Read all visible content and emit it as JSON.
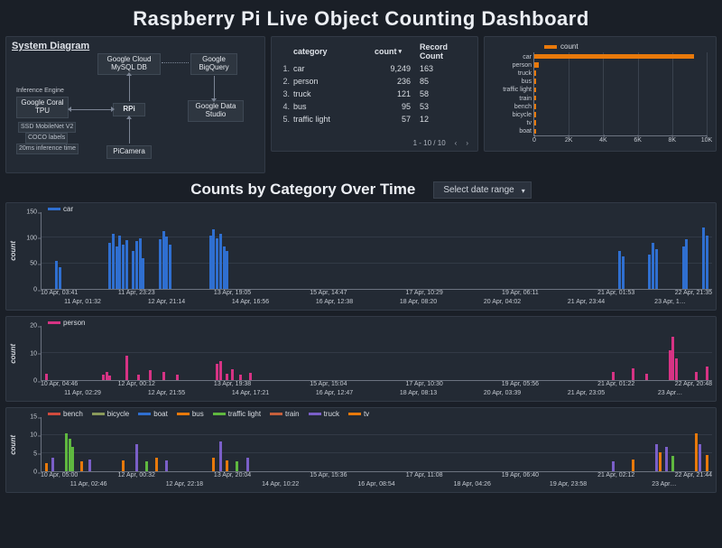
{
  "title": "Raspberry Pi Live Object Counting Dashboard",
  "section_title": "Counts by Category Over Time",
  "date_selector": {
    "label": "Select date range"
  },
  "system_diagram": {
    "title": "System Diagram",
    "nodes": {
      "gcloud": "Google Cloud\nMySQL DB",
      "bigquery": "Google\nBigQuery",
      "rpi": "RPi",
      "datastudio": "Google Data\nStudio",
      "picamera": "PiCamera",
      "inference_label": "Inference Engine",
      "coral": "Google Coral\nTPU",
      "detail1": "SSD MobileNet V2",
      "detail2": "COCO labels",
      "detail3": "20ms inference time"
    }
  },
  "table": {
    "headers": {
      "category": "category",
      "count": "count",
      "record_count": "Record Count"
    },
    "rows": [
      {
        "idx": "1.",
        "category": "car",
        "count": "9,249",
        "record_count": "163"
      },
      {
        "idx": "2.",
        "category": "person",
        "count": "236",
        "record_count": "85"
      },
      {
        "idx": "3.",
        "category": "truck",
        "count": "121",
        "record_count": "58"
      },
      {
        "idx": "4.",
        "category": "bus",
        "count": "95",
        "record_count": "53"
      },
      {
        "idx": "5.",
        "category": "traffic light",
        "count": "57",
        "record_count": "12"
      }
    ],
    "pager": "1 - 10 / 10"
  },
  "chart_data": {
    "type": "bar",
    "orientation": "horizontal",
    "title": "",
    "legend": "count",
    "xlabel": "",
    "ylabel": "",
    "xlim": [
      0,
      10000
    ],
    "xticks": [
      0,
      2000,
      4000,
      6000,
      8000,
      10000
    ],
    "xtick_labels": [
      "0",
      "2K",
      "4K",
      "6K",
      "8K",
      "10K"
    ],
    "categories": [
      "car",
      "person",
      "truck",
      "bus",
      "traffic light",
      "train",
      "bench",
      "bicycle",
      "tv",
      "boat"
    ],
    "values": [
      9249,
      236,
      121,
      95,
      57,
      40,
      30,
      25,
      20,
      15
    ],
    "color": "#e8790b"
  },
  "ts_ylabel": "count",
  "ts_car": {
    "legend": [
      {
        "name": "car",
        "color": "#2f6fd0"
      }
    ],
    "ymax": 150,
    "yticks": [
      0,
      50,
      100,
      150
    ],
    "xticks_top": [
      "10 Apr, 03:41",
      "11 Apr, 23:23",
      "13 Apr, 19:05",
      "15 Apr, 14:47",
      "17 Apr, 10:29",
      "19 Apr, 06:11",
      "21 Apr, 01:53",
      "22 Apr, 21:35"
    ],
    "xticks_bot": [
      "11 Apr, 01:32",
      "12 Apr, 21:14",
      "14 Apr, 16:56",
      "16 Apr, 12:38",
      "18 Apr, 08:20",
      "20 Apr, 04:02",
      "21 Apr, 23:44",
      "23 Apr, 1…"
    ],
    "bars": [
      {
        "x": 0.02,
        "h": 0.37,
        "c": "#2f6fd0"
      },
      {
        "x": 0.025,
        "h": 0.28,
        "c": "#2f6fd0"
      },
      {
        "x": 0.1,
        "h": 0.6,
        "c": "#2f6fd0"
      },
      {
        "x": 0.105,
        "h": 0.72,
        "c": "#2f6fd0"
      },
      {
        "x": 0.11,
        "h": 0.55,
        "c": "#2f6fd0"
      },
      {
        "x": 0.115,
        "h": 0.7,
        "c": "#2f6fd0"
      },
      {
        "x": 0.12,
        "h": 0.58,
        "c": "#2f6fd0"
      },
      {
        "x": 0.125,
        "h": 0.64,
        "c": "#2f6fd0"
      },
      {
        "x": 0.135,
        "h": 0.5,
        "c": "#2f6fd0"
      },
      {
        "x": 0.14,
        "h": 0.62,
        "c": "#2f6fd0"
      },
      {
        "x": 0.145,
        "h": 0.66,
        "c": "#2f6fd0"
      },
      {
        "x": 0.15,
        "h": 0.4,
        "c": "#2f6fd0"
      },
      {
        "x": 0.175,
        "h": 0.65,
        "c": "#2f6fd0"
      },
      {
        "x": 0.18,
        "h": 0.75,
        "c": "#2f6fd0"
      },
      {
        "x": 0.185,
        "h": 0.68,
        "c": "#2f6fd0"
      },
      {
        "x": 0.19,
        "h": 0.58,
        "c": "#2f6fd0"
      },
      {
        "x": 0.25,
        "h": 0.7,
        "c": "#2f6fd0"
      },
      {
        "x": 0.255,
        "h": 0.78,
        "c": "#2f6fd0"
      },
      {
        "x": 0.26,
        "h": 0.66,
        "c": "#2f6fd0"
      },
      {
        "x": 0.265,
        "h": 0.72,
        "c": "#2f6fd0"
      },
      {
        "x": 0.27,
        "h": 0.55,
        "c": "#2f6fd0"
      },
      {
        "x": 0.275,
        "h": 0.5,
        "c": "#2f6fd0"
      },
      {
        "x": 0.86,
        "h": 0.5,
        "c": "#2f6fd0"
      },
      {
        "x": 0.865,
        "h": 0.42,
        "c": "#2f6fd0"
      },
      {
        "x": 0.905,
        "h": 0.45,
        "c": "#2f6fd0"
      },
      {
        "x": 0.91,
        "h": 0.6,
        "c": "#2f6fd0"
      },
      {
        "x": 0.915,
        "h": 0.52,
        "c": "#2f6fd0"
      },
      {
        "x": 0.955,
        "h": 0.55,
        "c": "#2f6fd0"
      },
      {
        "x": 0.96,
        "h": 0.65,
        "c": "#2f6fd0"
      },
      {
        "x": 0.985,
        "h": 0.8,
        "c": "#2f6fd0"
      },
      {
        "x": 0.99,
        "h": 0.7,
        "c": "#2f6fd0"
      }
    ]
  },
  "ts_person": {
    "legend": [
      {
        "name": "person",
        "color": "#d63384"
      }
    ],
    "ymax": 20,
    "yticks": [
      0,
      10,
      20
    ],
    "xticks_top": [
      "10 Apr, 04:46",
      "12 Apr, 00:12",
      "13 Apr, 19:38",
      "15 Apr, 15:04",
      "17 Apr, 10:30",
      "19 Apr, 05:56",
      "21 Apr, 01:22",
      "22 Apr, 20:48"
    ],
    "xticks_bot": [
      "11 Apr, 02:29",
      "12 Apr, 21:55",
      "14 Apr, 17:21",
      "16 Apr, 12:47",
      "18 Apr, 08:13",
      "20 Apr, 03:39",
      "21 Apr, 23:05",
      "23 Apr…"
    ],
    "bars": [
      {
        "x": 0.005,
        "h": 0.12,
        "c": "#d63384"
      },
      {
        "x": 0.09,
        "h": 0.1,
        "c": "#d63384"
      },
      {
        "x": 0.095,
        "h": 0.15,
        "c": "#d63384"
      },
      {
        "x": 0.1,
        "h": 0.08,
        "c": "#d63384"
      },
      {
        "x": 0.125,
        "h": 0.45,
        "c": "#d63384"
      },
      {
        "x": 0.143,
        "h": 0.1,
        "c": "#d63384"
      },
      {
        "x": 0.16,
        "h": 0.18,
        "c": "#d63384"
      },
      {
        "x": 0.18,
        "h": 0.15,
        "c": "#d63384"
      },
      {
        "x": 0.2,
        "h": 0.1,
        "c": "#d63384"
      },
      {
        "x": 0.26,
        "h": 0.3,
        "c": "#d63384"
      },
      {
        "x": 0.265,
        "h": 0.35,
        "c": "#d63384"
      },
      {
        "x": 0.275,
        "h": 0.12,
        "c": "#d63384"
      },
      {
        "x": 0.283,
        "h": 0.2,
        "c": "#d63384"
      },
      {
        "x": 0.295,
        "h": 0.1,
        "c": "#d63384"
      },
      {
        "x": 0.31,
        "h": 0.14,
        "c": "#d63384"
      },
      {
        "x": 0.85,
        "h": 0.15,
        "c": "#d63384"
      },
      {
        "x": 0.88,
        "h": 0.22,
        "c": "#d63384"
      },
      {
        "x": 0.9,
        "h": 0.12,
        "c": "#d63384"
      },
      {
        "x": 0.935,
        "h": 0.55,
        "c": "#d63384"
      },
      {
        "x": 0.94,
        "h": 0.8,
        "c": "#d63384"
      },
      {
        "x": 0.945,
        "h": 0.4,
        "c": "#d63384"
      },
      {
        "x": 0.975,
        "h": 0.15,
        "c": "#d63384"
      },
      {
        "x": 0.99,
        "h": 0.25,
        "c": "#d63384"
      }
    ]
  },
  "ts_other": {
    "legend": [
      {
        "name": "bench",
        "color": "#d14b3d"
      },
      {
        "name": "bicycle",
        "color": "#8a9a5b"
      },
      {
        "name": "boat",
        "color": "#2f6fd0"
      },
      {
        "name": "bus",
        "color": "#e8790b"
      },
      {
        "name": "traffic light",
        "color": "#5fb83f"
      },
      {
        "name": "train",
        "color": "#c65f3b"
      },
      {
        "name": "truck",
        "color": "#7a5fc8"
      },
      {
        "name": "tv",
        "color": "#e8790b"
      }
    ],
    "ymax": 15,
    "yticks": [
      0,
      5,
      10,
      15
    ],
    "xticks_top": [
      "10 Apr, 05:00",
      "12 Apr, 00:32",
      "13 Apr, 20:04",
      "15 Apr, 15:36",
      "17 Apr, 11:08",
      "19 Apr, 06:40",
      "21 Apr, 02:12",
      "22 Apr, 21:44"
    ],
    "xticks_bot": [
      "11 Apr, 02:46",
      "12 Apr, 22:18",
      "14 Apr, 10:22",
      "16 Apr, 08:54",
      "18 Apr, 04:26",
      "19 Apr, 23:58",
      "23 Apr…"
    ],
    "bars": [
      {
        "x": 0.005,
        "h": 0.15,
        "c": "#e8790b"
      },
      {
        "x": 0.015,
        "h": 0.25,
        "c": "#7a5fc8"
      },
      {
        "x": 0.035,
        "h": 0.7,
        "c": "#5fb83f"
      },
      {
        "x": 0.04,
        "h": 0.6,
        "c": "#5fb83f"
      },
      {
        "x": 0.045,
        "h": 0.45,
        "c": "#5fb83f"
      },
      {
        "x": 0.058,
        "h": 0.18,
        "c": "#e8790b"
      },
      {
        "x": 0.07,
        "h": 0.22,
        "c": "#7a5fc8"
      },
      {
        "x": 0.12,
        "h": 0.2,
        "c": "#e8790b"
      },
      {
        "x": 0.14,
        "h": 0.5,
        "c": "#7a5fc8"
      },
      {
        "x": 0.155,
        "h": 0.18,
        "c": "#5fb83f"
      },
      {
        "x": 0.17,
        "h": 0.25,
        "c": "#e8790b"
      },
      {
        "x": 0.185,
        "h": 0.2,
        "c": "#7a5fc8"
      },
      {
        "x": 0.255,
        "h": 0.25,
        "c": "#e8790b"
      },
      {
        "x": 0.265,
        "h": 0.55,
        "c": "#7a5fc8"
      },
      {
        "x": 0.275,
        "h": 0.2,
        "c": "#e8790b"
      },
      {
        "x": 0.29,
        "h": 0.18,
        "c": "#5fb83f"
      },
      {
        "x": 0.305,
        "h": 0.25,
        "c": "#7a5fc8"
      },
      {
        "x": 0.85,
        "h": 0.18,
        "c": "#7a5fc8"
      },
      {
        "x": 0.88,
        "h": 0.22,
        "c": "#e8790b"
      },
      {
        "x": 0.915,
        "h": 0.5,
        "c": "#7a5fc8"
      },
      {
        "x": 0.92,
        "h": 0.35,
        "c": "#e8790b"
      },
      {
        "x": 0.93,
        "h": 0.45,
        "c": "#7a5fc8"
      },
      {
        "x": 0.94,
        "h": 0.28,
        "c": "#5fb83f"
      },
      {
        "x": 0.975,
        "h": 0.7,
        "c": "#e8790b"
      },
      {
        "x": 0.98,
        "h": 0.5,
        "c": "#7a5fc8"
      },
      {
        "x": 0.99,
        "h": 0.3,
        "c": "#e8790b"
      }
    ]
  }
}
